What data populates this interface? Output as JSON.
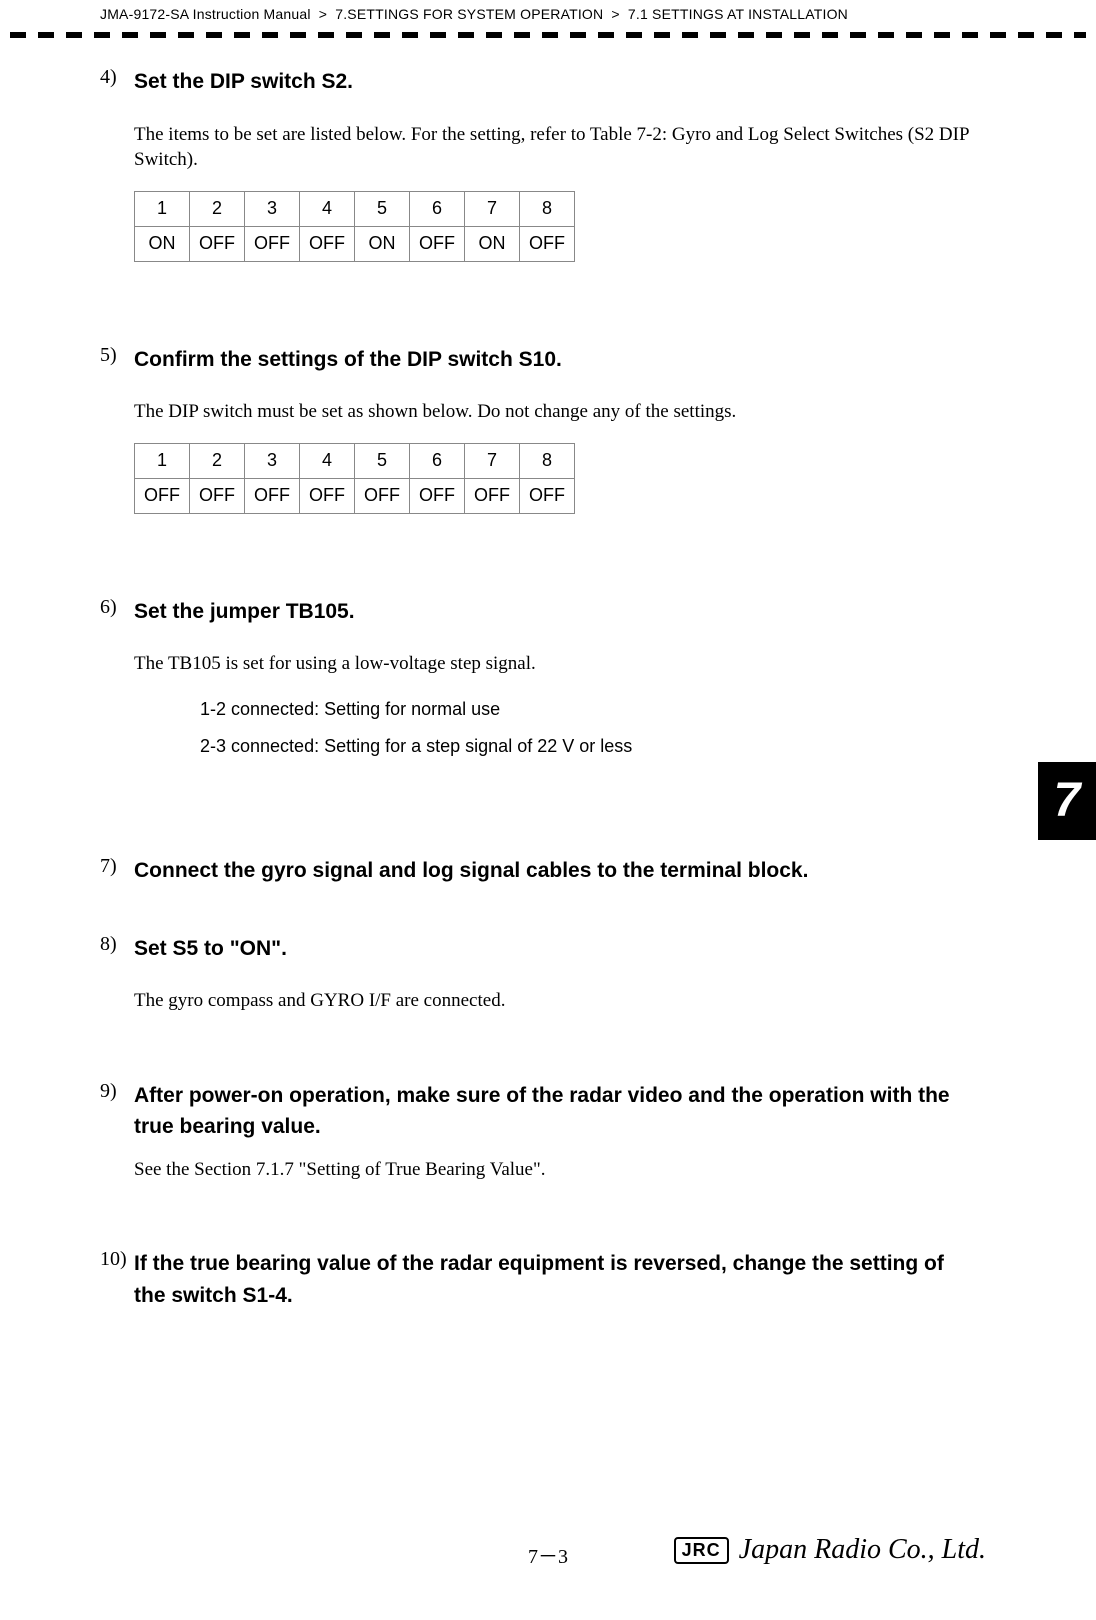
{
  "header": {
    "manual": "JMA-9172-SA Instruction Manual",
    "chapter": "7.SETTINGS FOR SYSTEM OPERATION",
    "section": "7.1  SETTINGS AT INSTALLATION",
    "sep": ">"
  },
  "steps": {
    "s4": {
      "num": "4)",
      "title": "Set the DIP switch S2.",
      "body": "The items to be set are listed below. For the setting, refer to Table 7-2: Gyro and Log Select Switches (S2 DIP Switch).",
      "table": {
        "headers": [
          "1",
          "2",
          "3",
          "4",
          "5",
          "6",
          "7",
          "8"
        ],
        "values": [
          "ON",
          "OFF",
          "OFF",
          "OFF",
          "ON",
          "OFF",
          "ON",
          "OFF"
        ]
      }
    },
    "s5": {
      "num": "5)",
      "title": "Confirm the settings of the DIP switch S10.",
      "body": "The DIP switch must be set as shown below. Do not change any of the settings.",
      "table": {
        "headers": [
          "1",
          "2",
          "3",
          "4",
          "5",
          "6",
          "7",
          "8"
        ],
        "values": [
          "OFF",
          "OFF",
          "OFF",
          "OFF",
          "OFF",
          "OFF",
          "OFF",
          "OFF"
        ]
      }
    },
    "s6": {
      "num": "6)",
      "title": "Set the jumper TB105.",
      "body": "The TB105 is set for using a low-voltage step signal.",
      "jumper": {
        "row1": "1-2 connected:  Setting for normal use",
        "row2": "2-3 connected:  Setting for a step signal of 22 V or less"
      }
    },
    "s7": {
      "num": "7)",
      "title": "Connect the gyro signal and log signal cables to the terminal block."
    },
    "s8": {
      "num": "8)",
      "title": "Set S5 to \"ON\".",
      "body": "The gyro compass and GYRO I/F are connected."
    },
    "s9": {
      "num": "9)",
      "title": "After power-on operation, make sure of the radar video and the operation with the true bearing value.",
      "body": "See the Section 7.1.7 \"Setting of True Bearing Value\"."
    },
    "s10": {
      "num": "10)",
      "title": "If the true bearing value of the radar equipment is reversed, change the setting of the switch S1-4."
    }
  },
  "chapter_tab": "7",
  "footer": {
    "page": "7－3",
    "logo_box": "JRC",
    "logo_script": "Japan Radio Co., Ltd."
  }
}
